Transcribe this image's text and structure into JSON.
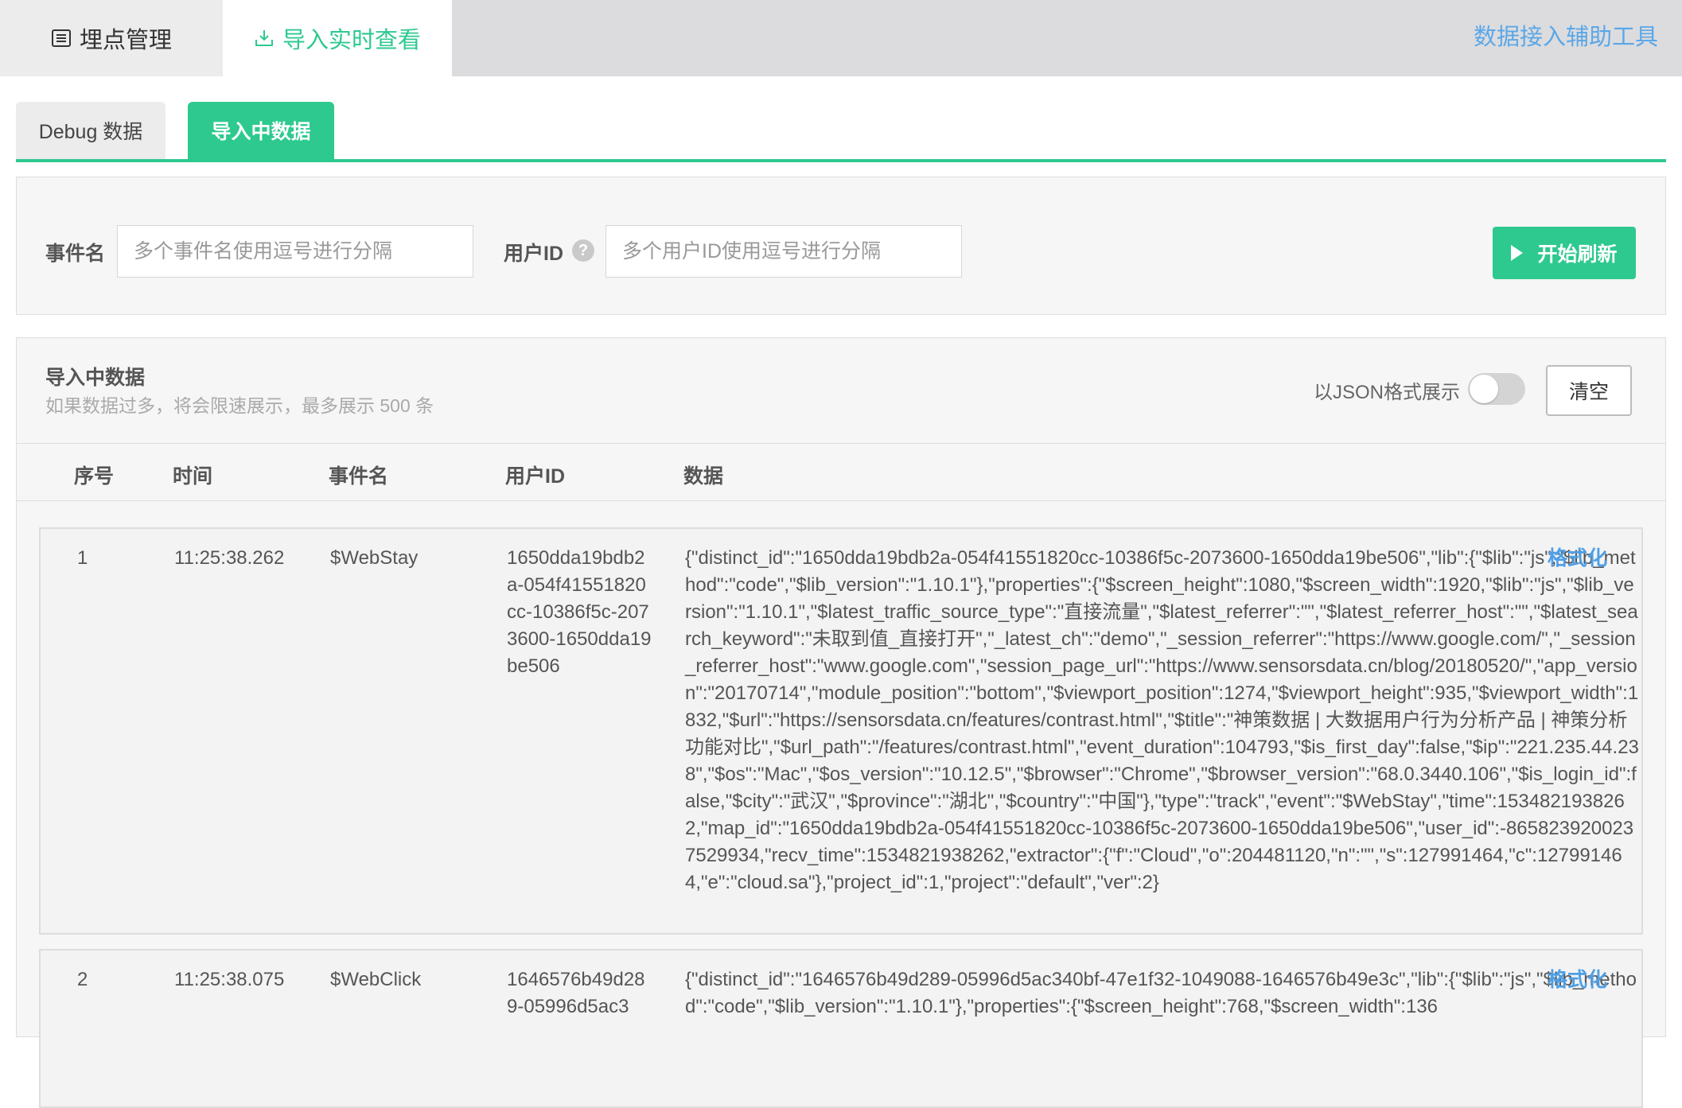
{
  "top_tabs": [
    {
      "label": "埋点管理",
      "icon": "list-icon"
    },
    {
      "label": "导入实时查看",
      "icon": "import-icon"
    }
  ],
  "helper_link": "数据接入辅助工具",
  "sub_tabs": [
    {
      "label": "Debug 数据"
    },
    {
      "label": "导入中数据"
    }
  ],
  "filter": {
    "event_label": "事件名",
    "event_placeholder": "多个事件名使用逗号进行分隔",
    "user_label": "用户ID",
    "help_icon": "?",
    "user_placeholder": "多个用户ID使用逗号进行分隔",
    "refresh_label": "开始刷新"
  },
  "panel": {
    "title": "导入中数据",
    "subtitle": "如果数据过多，将会限速展示，最多展示 500 条",
    "json_toggle_label": "以JSON格式展示",
    "json_toggle_on": false,
    "clear_label": "清空"
  },
  "table": {
    "headers": [
      "序号",
      "时间",
      "事件名",
      "用户ID",
      "数据"
    ],
    "format_label": "格式化",
    "rows": [
      {
        "seq": "1",
        "time": "11:25:38.262",
        "event": "$WebStay",
        "user_id": "1650dda19bdb2a-054f41551820cc-10386f5c-2073600-1650dda19be506",
        "data": "{\"distinct_id\":\"1650dda19bdb2a-054f41551820cc-10386f5c-2073600-1650dda19be506\",\"lib\":{\"$lib\":\"js\",\"$lib_method\":\"code\",\"$lib_version\":\"1.10.1\"},\"properties\":{\"$screen_height\":1080,\"$screen_width\":1920,\"$lib\":\"js\",\"$lib_version\":\"1.10.1\",\"$latest_traffic_source_type\":\"直接流量\",\"$latest_referrer\":\"\",\"$latest_referrer_host\":\"\",\"$latest_search_keyword\":\"未取到值_直接打开\",\"_latest_ch\":\"demo\",\"_session_referrer\":\"https://www.google.com/\",\"_session_referrer_host\":\"www.google.com\",\"session_page_url\":\"https://www.sensorsdata.cn/blog/20180520/\",\"app_version\":\"20170714\",\"module_position\":\"bottom\",\"$viewport_position\":1274,\"$viewport_height\":935,\"$viewport_width\":1832,\"$url\":\"https://sensorsdata.cn/features/contrast.html\",\"$title\":\"神策数据 | 大数据用户行为分析产品 | 神策分析功能对比\",\"$url_path\":\"/features/contrast.html\",\"event_duration\":104793,\"$is_first_day\":false,\"$ip\":\"221.235.44.238\",\"$os\":\"Mac\",\"$os_version\":\"10.12.5\",\"$browser\":\"Chrome\",\"$browser_version\":\"68.0.3440.106\",\"$is_login_id\":false,\"$city\":\"武汉\",\"$province\":\"湖北\",\"$country\":\"中国\"},\"type\":\"track\",\"event\":\"$WebStay\",\"time\":1534821938262,\"map_id\":\"1650dda19bdb2a-054f41551820cc-10386f5c-2073600-1650dda19be506\",\"user_id\":-8658239200237529934,\"recv_time\":1534821938262,\"extractor\":{\"f\":\"Cloud\",\"o\":204481120,\"n\":\"\",\"s\":127991464,\"c\":127991464,\"e\":\"cloud.sa\"},\"project_id\":1,\"project\":\"default\",\"ver\":2}"
      },
      {
        "seq": "2",
        "time": "11:25:38.075",
        "event": "$WebClick",
        "user_id": "1646576b49d289-05996d5ac3",
        "data": "{\"distinct_id\":\"1646576b49d289-05996d5ac340bf-47e1f32-1049088-1646576b49e3c\",\"lib\":{\"$lib\":\"js\",\"$lib_method\":\"code\",\"$lib_version\":\"1.10.1\"},\"properties\":{\"$screen_height\":768,\"$screen_width\":136"
      }
    ]
  },
  "colors": {
    "accent": "#2ec98f",
    "link": "#4e9fe5",
    "topbar": "#dcdcde"
  }
}
